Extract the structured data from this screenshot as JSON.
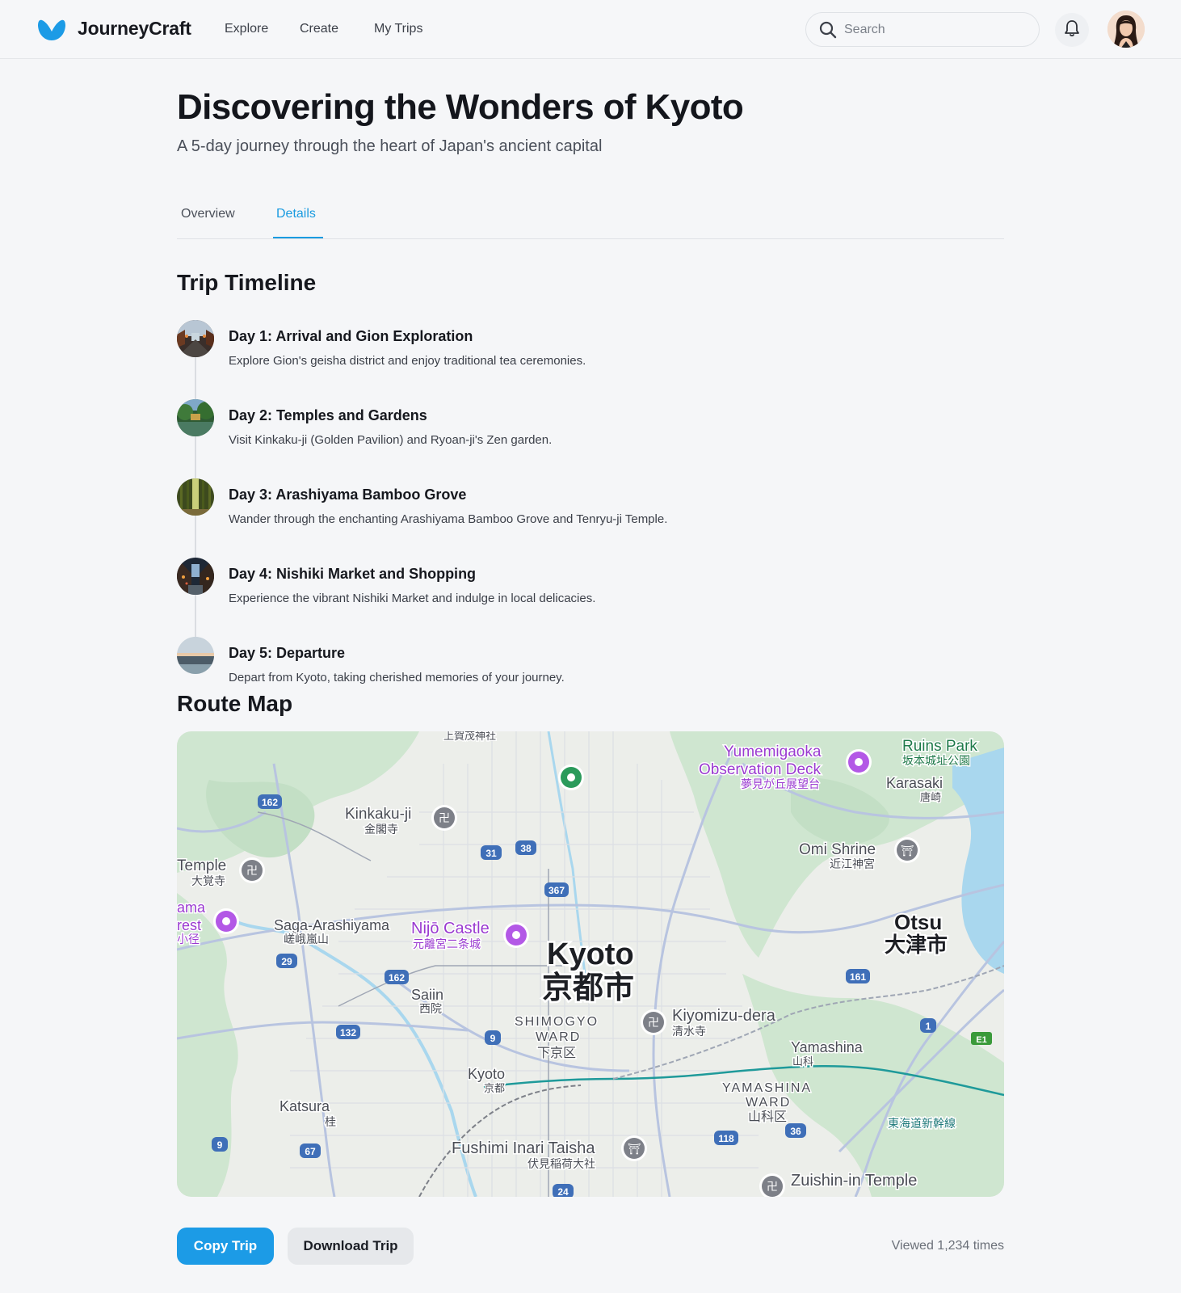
{
  "header": {
    "brand": "JourneyCraft",
    "nav": [
      "Explore",
      "Create",
      "My Trips"
    ],
    "search_placeholder": "Search",
    "icons": {
      "logo": "butterfly-logo-icon",
      "search": "search-icon",
      "bell": "bell-icon"
    },
    "brand_color": "#1c9be6"
  },
  "trip": {
    "title": "Discovering the Wonders of Kyoto",
    "subtitle": "A 5-day journey through the heart of Japan's ancient capital"
  },
  "tabs": {
    "overview": "Overview",
    "details": "Details",
    "active": "Details"
  },
  "timeline": {
    "heading": "Trip Timeline",
    "days": [
      {
        "title": "Day 1: Arrival and Gion Exploration",
        "desc": "Explore Gion's geisha district and enjoy traditional tea ceremonies."
      },
      {
        "title": "Day 2: Temples and Gardens",
        "desc": "Visit Kinkaku-ji (Golden Pavilion) and Ryoan-ji's Zen garden."
      },
      {
        "title": "Day 3: Arashiyama Bamboo Grove",
        "desc": "Wander through the enchanting Arashiyama Bamboo Grove and Tenryu-ji Temple."
      },
      {
        "title": "Day 4: Nishiki Market and Shopping",
        "desc": "Experience the vibrant Nishiki Market and indulge in local delicacies."
      },
      {
        "title": "Day 5: Departure",
        "desc": "Depart from Kyoto, taking cherished memories of your journey."
      }
    ]
  },
  "map": {
    "heading": "Route Map",
    "labels": {
      "city_en": "Kyoto",
      "city_jp": "京都市",
      "kinkakuji": "Kinkaku-ji",
      "kinkakuji_jp": "金閣寺",
      "temple": "Temple",
      "temple_jp": "大覚寺",
      "saga": "Saga-Arashiyama",
      "saga_jp": "嵯峨嵐山",
      "ama": "ama",
      "rest": "rest",
      "rest_jp": "小径",
      "nijo": "Nijō Castle",
      "nijo_jp": "元離宮二条城",
      "saiin": "Saiin",
      "saiin_jp": "西院",
      "shimogyo1": "SHIMOGYO",
      "shimogyo2": "WARD",
      "shimogyo_jp": "下京区",
      "kyoto_st": "Kyoto",
      "kyoto_st_jp": "京都",
      "katsura": "Katsura",
      "katsura_jp": "桂",
      "fushimi": "Fushimi Inari Taisha",
      "fushimi_jp": "伏見稲荷大社",
      "kiyomizu": "Kiyomizu-dera",
      "kiyomizu_jp": "清水寺",
      "yamashina": "Yamashina",
      "yamashina_jp": "山科",
      "yamashina_w1": "YAMASHINA",
      "yamashina_w2": "WARD",
      "yamashina_w_jp": "山科区",
      "zuishin": "Zuishin-in Temple",
      "yume1": "Yumemigaoka",
      "yume2": "Observation Deck",
      "yume_jp": "夢見が丘展望台",
      "ruins": "Ruins Park",
      "ruins_jp": "坂本城址公園",
      "karasaki": "Karasaki",
      "karasaki_jp": "唐崎",
      "omi": "Omi Shrine",
      "omi_jp": "近江神宮",
      "otsu": "Otsu",
      "otsu_jp": "大津市",
      "shinkansen": "東海道新幹線",
      "top_cut": "上賀茂神社",
      "e1": "E1",
      "routes": [
        "162",
        "31",
        "38",
        "367",
        "29",
        "162",
        "132",
        "9",
        "161",
        "1",
        "118",
        "36",
        "67",
        "9",
        "24"
      ]
    },
    "colors": {
      "water": "#a9d7ee",
      "forest": "#cde6cf",
      "road": "#b8c4e0",
      "poi_purple": "#b358e6",
      "poi_gray": "#7d8088",
      "rail_teal": "#1f9a9a"
    }
  },
  "actions": {
    "copy": "Copy Trip",
    "download": "Download Trip",
    "views": "Viewed 1,234 times"
  }
}
